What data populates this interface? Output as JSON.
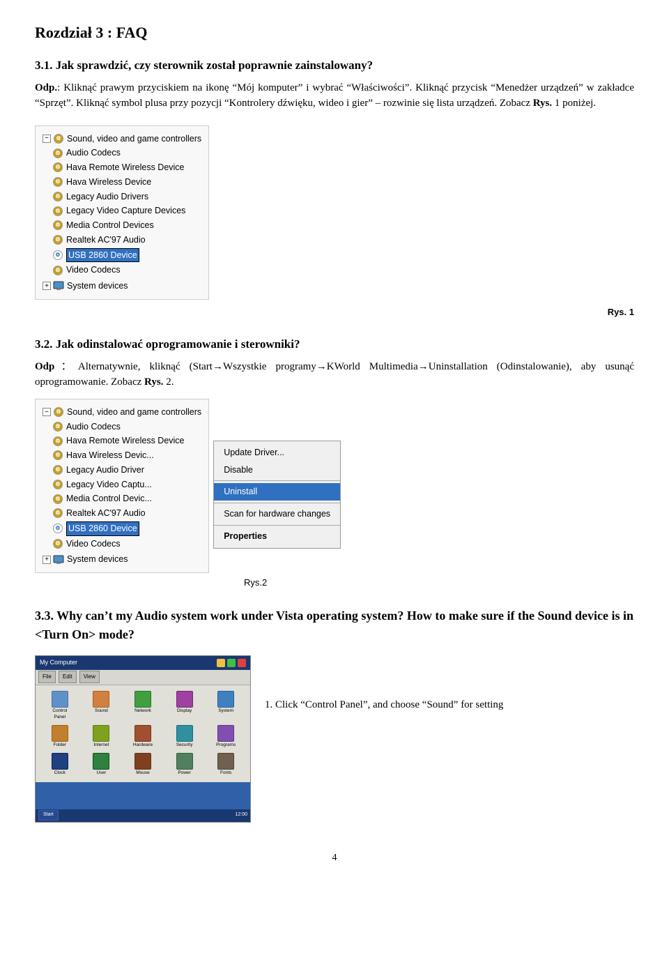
{
  "chapter": {
    "title": "Rozdział 3 : FAQ"
  },
  "section1": {
    "heading": "3.1. Jak sprawdzić, czy sterownik został poprawnie zainstalowany?",
    "q_label": "Odp.",
    "q_text": ": Kliknąć prawym przyciskiem na ikonę “Mój komputer” i wybrać “Właściwości”. Kliknąć przycisk “Menedżer urządzeń” w zakładce “Sprzęt”. Kliknąć symbol plusa przy pozycji “Kontrolery dźwięku, wideo i gier” – rozwinie się lista urządzeń. Zobacz ",
    "bold_text": "Rys.",
    "end_text": " 1 poniżej.",
    "fig_label": "Rys. 1"
  },
  "tree1": {
    "root": "Sound, video and game controllers",
    "items": [
      "Audio Codecs",
      "Hava Remote Wireless Device",
      "Hava Wireless Device",
      "Legacy Audio Drivers",
      "Legacy Video Capture Devices",
      "Media Control Devices",
      "Realtek AC'97 Audio",
      "USB 2860 Device",
      "Video Codecs"
    ],
    "system_devices": "System devices",
    "highlighted_item": "USB 2860 Device"
  },
  "section2": {
    "heading": "3.2. Jak odinstalować oprogramowanie i sterowniki?",
    "q_label": "Odp",
    "q_text": "：Alternatywnie, kliknąć (Start→Wszystkie programy→KWorld Multimedia→Uninstallation (Odinstalowanie), aby usunąć oprogramowanie. Zobacz ",
    "bold_text": "Rys.",
    "end_text": " 2.",
    "fig_label": "Rys.2"
  },
  "tree2": {
    "root": "Sound, video and game controllers",
    "items": [
      "Audio Codecs",
      "Hava Remote Wireless Device",
      "Hava Wireless Device",
      "Legacy Audio Driver",
      "Legacy Video Captu...",
      "Media Control Devic...",
      "Realtek AC'97 Audio",
      "USB 2860 Device",
      "Video Codecs"
    ],
    "system_devices": "System devices",
    "highlighted_item": "USB 2860 Device"
  },
  "context_menu": {
    "items": [
      {
        "label": "Update Driver...",
        "bold": false,
        "highlighted": false
      },
      {
        "label": "Disable",
        "bold": false,
        "highlighted": false
      },
      {
        "label": "Uninstall",
        "bold": false,
        "highlighted": true
      },
      {
        "label": "Scan for hardware changes",
        "bold": false,
        "highlighted": false
      },
      {
        "label": "Properties",
        "bold": true,
        "highlighted": false
      }
    ]
  },
  "section3": {
    "heading": "3.3. Why can’t my Audio system work under Vista operating system? How to make sure if the Sound device is in <Turn On> mode?",
    "step1_text": "1. Click “Control Panel”, and choose “Sound” for setting"
  },
  "page_number": "4"
}
